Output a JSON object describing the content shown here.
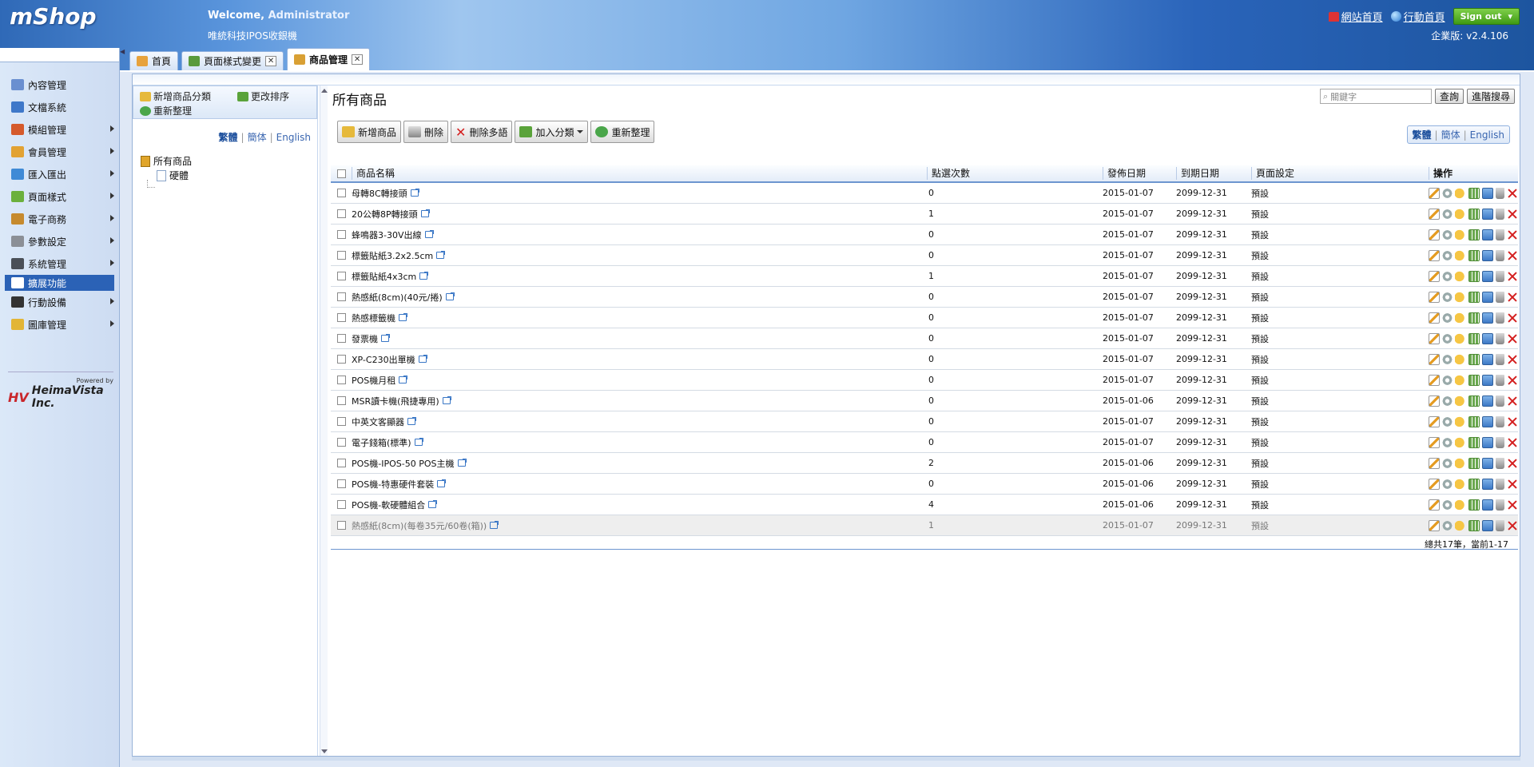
{
  "header": {
    "logo": "mShop",
    "welcome_prefix": "Welcome,",
    "welcome_user": "Administrator",
    "company": "唯統科技IPOS收銀機",
    "link_site_home": "網站首頁",
    "link_mobile_home": "行動首頁",
    "sign_out": "Sign out",
    "version": "企業版: v2.4.106"
  },
  "sidebar": {
    "items": [
      {
        "label": "內容管理",
        "icon": "calendar-icon",
        "color": "#6a8fd0",
        "arrow": false
      },
      {
        "label": "文檔系統",
        "icon": "chart-icon",
        "color": "#3f78c9",
        "arrow": false
      },
      {
        "label": "模組管理",
        "icon": "modules-icon",
        "color": "#d55a2c",
        "arrow": true
      },
      {
        "label": "會員管理",
        "icon": "members-icon",
        "color": "#e2a233",
        "arrow": true
      },
      {
        "label": "匯入匯出",
        "icon": "import-export-icon",
        "color": "#3f8ad6",
        "arrow": true
      },
      {
        "label": "頁面樣式",
        "icon": "page-style-icon",
        "color": "#6bb03d",
        "arrow": true
      },
      {
        "label": "電子商務",
        "icon": "ecommerce-icon",
        "color": "#c68a2e",
        "arrow": true
      },
      {
        "label": "參數設定",
        "icon": "settings-icon",
        "color": "#8b8f96",
        "arrow": true
      },
      {
        "label": "系統管理",
        "icon": "system-icon",
        "color": "#4a4f57",
        "arrow": true
      },
      {
        "label": "擴展功能",
        "icon": "extension-icon",
        "color": "#ffffff",
        "arrow": false,
        "active": true
      },
      {
        "label": "行動設備",
        "icon": "mobile-icon",
        "color": "#333333",
        "arrow": true
      },
      {
        "label": "圖庫管理",
        "icon": "gallery-icon",
        "color": "#e2b536",
        "arrow": true
      }
    ],
    "powered_by": "Powered by",
    "brand": "HeimaVista Inc.",
    "brand_mark": "HV"
  },
  "tabs": [
    {
      "label": "首頁",
      "icon": "home-icon",
      "closable": false,
      "active": false
    },
    {
      "label": "頁面樣式變更",
      "icon": "page-style-icon",
      "closable": true,
      "active": false
    },
    {
      "label": "商品管理",
      "icon": "edit-icon",
      "closable": true,
      "active": true
    }
  ],
  "tree_panel": {
    "add_category": "新增商品分類",
    "change_order": "更改排序",
    "refresh": "重新整理",
    "lang_trad": "繁體",
    "lang_simp": "簡体",
    "lang_en": "English",
    "root_node": "所有商品",
    "child_node": "硬體"
  },
  "main": {
    "title": "所有商品",
    "search_placeholder": "關鍵字",
    "search_button": "查詢",
    "advanced_search_button": "進階搜尋",
    "toolbar": {
      "add": "新增商品",
      "delete": "刪除",
      "delete_multilang": "刪除多語",
      "add_to_category": "加入分類",
      "refresh": "重新整理"
    },
    "lang_trad": "繁體",
    "lang_simp": "簡体",
    "lang_en": "English",
    "columns": [
      "商品名稱",
      "點選次數",
      "發佈日期",
      "到期日期",
      "頁面設定",
      "操作"
    ],
    "rows": [
      {
        "name": "母轉8C轉接頭",
        "clicks": "0",
        "publish": "2015-01-07",
        "expire": "2099-12-31",
        "page": "預設"
      },
      {
        "name": "20公轉8P轉接頭",
        "clicks": "1",
        "publish": "2015-01-07",
        "expire": "2099-12-31",
        "page": "預設"
      },
      {
        "name": "蜂鳴器3-30V出線",
        "clicks": "0",
        "publish": "2015-01-07",
        "expire": "2099-12-31",
        "page": "預設"
      },
      {
        "name": "標籤貼紙3.2x2.5cm",
        "clicks": "0",
        "publish": "2015-01-07",
        "expire": "2099-12-31",
        "page": "預設"
      },
      {
        "name": "標籤貼紙4x3cm",
        "clicks": "1",
        "publish": "2015-01-07",
        "expire": "2099-12-31",
        "page": "預設"
      },
      {
        "name": "熱感紙(8cm)(40元/捲)",
        "clicks": "0",
        "publish": "2015-01-07",
        "expire": "2099-12-31",
        "page": "預設"
      },
      {
        "name": "熱感標籤機",
        "clicks": "0",
        "publish": "2015-01-07",
        "expire": "2099-12-31",
        "page": "預設"
      },
      {
        "name": "發票機",
        "clicks": "0",
        "publish": "2015-01-07",
        "expire": "2099-12-31",
        "page": "預設"
      },
      {
        "name": "XP-C230出單機",
        "clicks": "0",
        "publish": "2015-01-07",
        "expire": "2099-12-31",
        "page": "預設"
      },
      {
        "name": "POS機月租",
        "clicks": "0",
        "publish": "2015-01-07",
        "expire": "2099-12-31",
        "page": "預設"
      },
      {
        "name": "MSR讀卡機(飛捷專用)",
        "clicks": "0",
        "publish": "2015-01-06",
        "expire": "2099-12-31",
        "page": "預設"
      },
      {
        "name": "中英文客顯器",
        "clicks": "0",
        "publish": "2015-01-07",
        "expire": "2099-12-31",
        "page": "預設"
      },
      {
        "name": "電子錢箱(標準)",
        "clicks": "0",
        "publish": "2015-01-07",
        "expire": "2099-12-31",
        "page": "預設"
      },
      {
        "name": "POS機-IPOS-50 POS主機",
        "clicks": "2",
        "publish": "2015-01-06",
        "expire": "2099-12-31",
        "page": "預設"
      },
      {
        "name": "POS機-特惠硬件套裝",
        "clicks": "0",
        "publish": "2015-01-06",
        "expire": "2099-12-31",
        "page": "預設"
      },
      {
        "name": "POS機-軟硬體組合",
        "clicks": "4",
        "publish": "2015-01-06",
        "expire": "2099-12-31",
        "page": "預設"
      },
      {
        "name": "熱感紙(8cm)(每卷35元/60卷(箱))",
        "clicks": "1",
        "publish": "2015-01-07",
        "expire": "2099-12-31",
        "page": "預設"
      }
    ],
    "total": "總共17筆，當前1-17"
  }
}
